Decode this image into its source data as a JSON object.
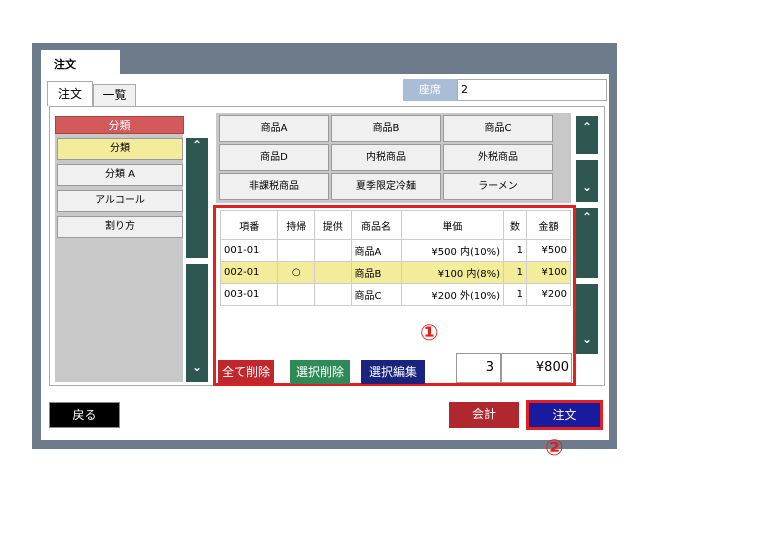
{
  "window": {
    "title": "注文"
  },
  "tabs": [
    {
      "label": "注文"
    },
    {
      "label": "一覧"
    }
  ],
  "seat": {
    "label": "座席",
    "value": "2"
  },
  "categories": {
    "header": "分類",
    "items": [
      "分類",
      "分類 A",
      "アルコール",
      "割り方"
    ]
  },
  "scroll_icons": {
    "up": "⌃",
    "down": "⌄"
  },
  "products": [
    "商品A",
    "商品B",
    "商品C",
    "商品D",
    "内税商品",
    "外税商品",
    "非課税商品",
    "夏季限定冷麺",
    "ラーメン"
  ],
  "orders": {
    "columns": [
      "項番",
      "持帰",
      "提供",
      "商品名",
      "単価",
      "数",
      "金額"
    ],
    "rows": [
      {
        "no": "001-01",
        "takeout": "",
        "served": "",
        "name": "商品A",
        "price": "¥500 内(10%)",
        "qty": "1",
        "amount": "¥500"
      },
      {
        "no": "002-01",
        "takeout": "○",
        "served": "",
        "name": "商品B",
        "price": "¥100 内(8%)",
        "qty": "1",
        "amount": "¥100"
      },
      {
        "no": "003-01",
        "takeout": "",
        "served": "",
        "name": "商品C",
        "price": "¥200 外(10%)",
        "qty": "1",
        "amount": "¥200"
      }
    ],
    "total_qty": "3",
    "total_amount": "¥800"
  },
  "actions": {
    "delete_all": "全て削除",
    "delete_selected": "選択削除",
    "edit_selected": "選択編集"
  },
  "footer": {
    "back": "戻る",
    "checkout": "会計",
    "order": "注文"
  },
  "annotations": {
    "one": "①",
    "two": "②"
  },
  "colors": {
    "frame": "#6e7b8b",
    "highlight": "#f3ec9a",
    "scroll": "#2f5752",
    "annotation_red": "#e32020"
  }
}
